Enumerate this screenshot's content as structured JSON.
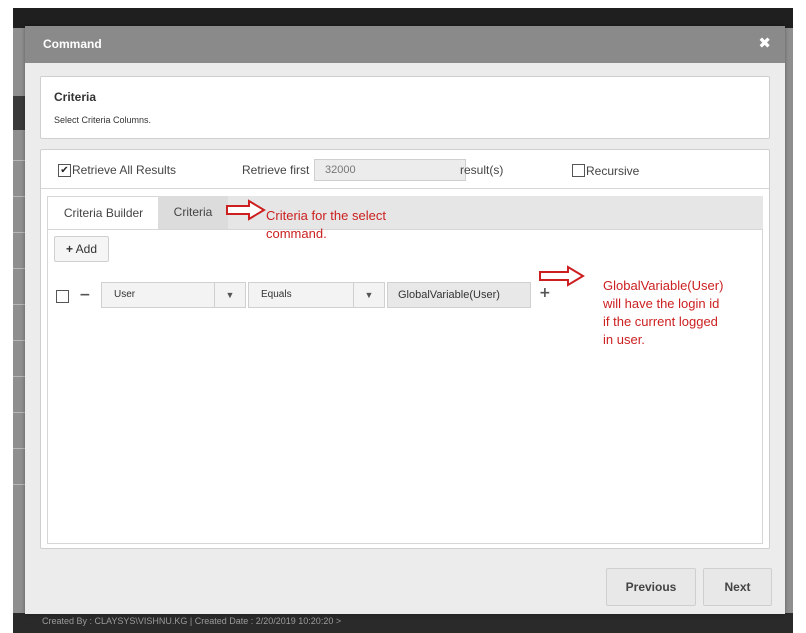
{
  "background_app": {
    "footer_text": "Created By : CLAYSYS\\VISHNU.KG | Created Date : 2/20/2019 10:20:20   >"
  },
  "modal": {
    "title": "Command",
    "close_glyph": "✖",
    "criteria_panel": {
      "heading": "Criteria",
      "subheading": "Select Criteria Columns."
    },
    "options": {
      "retrieve_all_checkbox": "✔",
      "retrieve_all_label": "Retrieve All Results",
      "retrieve_first_label": "Retrieve first",
      "retrieve_first_value": "32000",
      "results_suffix": "result(s)",
      "recursive_label": "Recursive"
    },
    "tabs": [
      {
        "label": "Criteria Builder"
      },
      {
        "label": "Criteria"
      }
    ],
    "builder": {
      "add_label": "Add",
      "add_icon": "+",
      "minus_icon": "−",
      "plus_icon": "+",
      "field_value": "User",
      "operator_value": "Equals",
      "dropdown_glyph": "▼",
      "criteria_value": "GlobalVariable(User)"
    },
    "buttons": {
      "previous": "Previous",
      "next": "Next"
    }
  },
  "annotations": {
    "tab_note_line1": "Criteria for the select",
    "tab_note_line2": "command.",
    "value_note_line1": "GlobalVariable(User)",
    "value_note_line2": "will have the login id",
    "value_note_line3": "if the current logged",
    "value_note_line4": "in user.",
    "arrow_color": "#cc1f1f"
  }
}
